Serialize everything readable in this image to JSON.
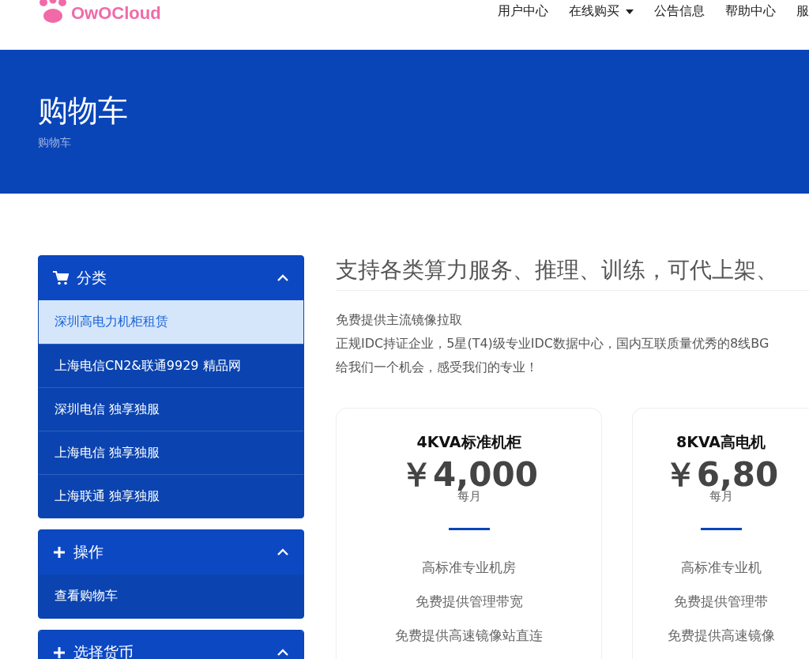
{
  "logo": {
    "text": "OwOCloud"
  },
  "nav": [
    {
      "label": "用户中心",
      "dropdown": false
    },
    {
      "label": "在线购买",
      "dropdown": true
    },
    {
      "label": "公告信息",
      "dropdown": false
    },
    {
      "label": "帮助中心",
      "dropdown": false
    },
    {
      "label": "服",
      "dropdown": false
    }
  ],
  "banner": {
    "title": "购物车",
    "breadcrumb": "购物车"
  },
  "sidebar": [
    {
      "kind": "cart",
      "title": "分类",
      "expanded": true,
      "items": [
        {
          "label": "深圳高电力机柜租赁",
          "selected": true
        },
        {
          "label": "上海电信CN2&联通9929 精品网",
          "selected": false
        },
        {
          "label": "深圳电信 独享独服",
          "selected": false
        },
        {
          "label": "上海电信 独享独服",
          "selected": false
        },
        {
          "label": "上海联通 独享独服",
          "selected": false
        }
      ]
    },
    {
      "kind": "plus",
      "title": "操作",
      "expanded": true,
      "items": [
        {
          "label": "查看购物车",
          "selected": false
        }
      ]
    },
    {
      "kind": "plus",
      "title": "选择货币",
      "expanded": true
    }
  ],
  "content": {
    "heading": "支持各类算力服务、推理、训练，可代上架、",
    "paragraphs": [
      "免费提供主流镜像拉取",
      "正规IDC持证企业，5星(T4)级专业IDC数据中心，国内互联质量优秀的8线BG",
      "给我们一个机会，感受我们的专业！"
    ]
  },
  "products": [
    {
      "name": "4KVA标准机柜",
      "price": "￥4,000",
      "period": "每月",
      "features": [
        "高标准专业机房",
        "免费提供管理带宽",
        "免费提供高速镜像站直连"
      ]
    },
    {
      "name": "8KVA高电机",
      "price": "￥6,80",
      "period": "每月",
      "features": [
        "高标准专业机",
        "免费提供管理带",
        "免费提供高速镜像"
      ]
    }
  ]
}
